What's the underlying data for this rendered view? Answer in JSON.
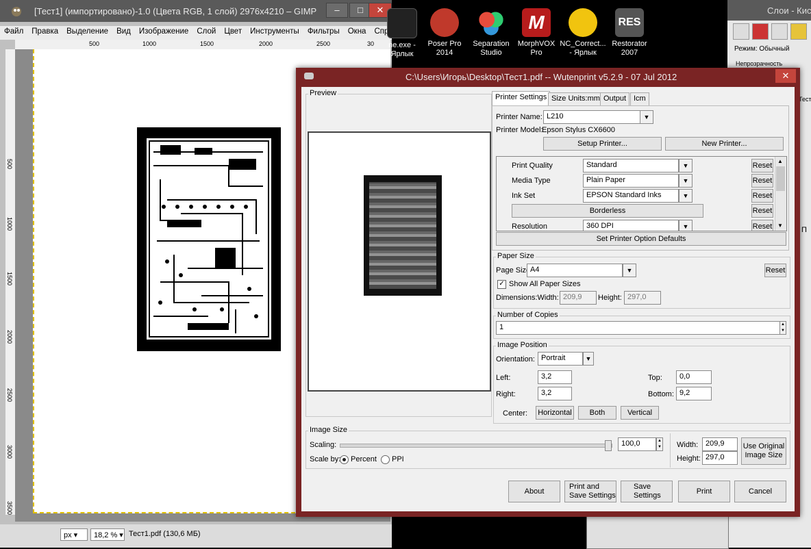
{
  "gimp": {
    "title": "[Тест1] (импортировано)-1.0 (Цвета RGB, 1 слой) 2976x4210 – GIMP",
    "menu": [
      "Файл",
      "Правка",
      "Выделение",
      "Вид",
      "Изображение",
      "Слой",
      "Цвет",
      "Инструменты",
      "Фильтры",
      "Окна",
      "Справ"
    ],
    "hruler_ticks": [
      "500",
      "1000",
      "1500",
      "2000",
      "2500",
      "30"
    ],
    "vruler_ticks": [
      "500",
      "1000",
      "1500",
      "2000",
      "2500",
      "3000",
      "3500"
    ],
    "unit": "px",
    "zoom": "18,2 %",
    "status": "Тест1.pdf (130,6 МБ)"
  },
  "desktop": {
    "icons": [
      {
        "label": "ne.exe - Ярлык",
        "icon": "app-icon",
        "color": "#333333"
      },
      {
        "label": "Poser Pro 2014",
        "icon": "poser-icon",
        "color": "#c0392b"
      },
      {
        "label": "Separation Studio",
        "icon": "separation-studio-icon",
        "color": "#27ae60"
      },
      {
        "label": "MorphVOX Pro",
        "icon": "morphvox-icon",
        "color": "#b71c1c"
      },
      {
        "label": "NC_Correct... - Ярлык",
        "icon": "nc-correct-icon",
        "color": "#f1c40f"
      },
      {
        "label": "Restorator 2007",
        "icon": "restorator-icon",
        "color": "#555555"
      }
    ]
  },
  "layers": {
    "title": "Слои - Кис",
    "mode": "Режим: Обычный",
    "opacity": "Непрозрачность",
    "cut_text1": "Тест",
    "cut_text2": "Π"
  },
  "dialog": {
    "title": "C:\\Users\\Игорь\\Desktop\\Тест1.pdf -- Wutenprint v5.2.9 - 07 Jul 2012",
    "close": "✕",
    "preview_title": "Preview",
    "tabs": [
      "Printer Settings",
      "Size Units:mm",
      "Output",
      "Icm"
    ],
    "printer_name_label": "Printer Name:",
    "printer_name": "L210",
    "printer_model_label": "Printer Model:",
    "printer_model": "Epson Stylus CX6600",
    "setup_printer": "Setup Printer...",
    "new_printer": "New Printer...",
    "options": [
      {
        "label": "Print Quality",
        "value": "Standard",
        "reset": "Reset"
      },
      {
        "label": "Media Type",
        "value": "Plain Paper",
        "reset": "Reset"
      },
      {
        "label": "Ink Set",
        "value": "EPSON Standard Inks",
        "reset": "Reset"
      },
      {
        "label": "",
        "value": "Borderless",
        "reset": "Reset"
      },
      {
        "label": "Resolution",
        "value": "360 DPI",
        "reset": "Reset"
      }
    ],
    "set_defaults": "Set Printer Option Defaults",
    "paper_size_title": "Paper Size",
    "page_size_label": "Page Size",
    "page_size": "A4",
    "paper_reset": "Reset",
    "show_all_label": "Show All Paper Sizes",
    "show_all_checked": "✓",
    "dimensions_label": "Dimensions:Width:",
    "dim_width": "209,9",
    "height_label": "Height:",
    "dim_height": "297,0",
    "copies_title": "Number of Copies",
    "copies": "1",
    "image_position_title": "Image Position",
    "orientation_label": "Orientation:",
    "orientation": "Portrait",
    "left_label": "Left:",
    "left": "3,2",
    "top_label": "Top:",
    "top": "0,0",
    "right_label": "Right:",
    "right": "3,2",
    "bottom_label": "Bottom:",
    "bottom": "9,2",
    "center_label": "Center:",
    "center_horizontal": "Horizontal",
    "center_both": "Both",
    "center_vertical": "Vertical",
    "image_size_title": "Image Size",
    "scaling_label": "Scaling:",
    "scaling": "100,0",
    "scaling_fraction": 1.0,
    "scale_by_label": "Scale by:",
    "percent_label": "Percent",
    "ppi_label": "PPI",
    "width_label": "Width:",
    "img_width": "209,9",
    "height2_label": "Height:",
    "img_height": "297,0",
    "use_original_1": "Use Original",
    "use_original_2": "Image Size",
    "about": "About",
    "print_save_1": "Print and",
    "print_save_2": "Save Settings",
    "save_settings_1": "Save",
    "save_settings_2": "Settings",
    "print": "Print",
    "cancel": "Cancel"
  },
  "colors": {
    "dialog_frame": "#7a2424",
    "gimp_title": "#5a5a5a",
    "selection_dash": "#e0c000",
    "close_red": "#c4453c"
  }
}
